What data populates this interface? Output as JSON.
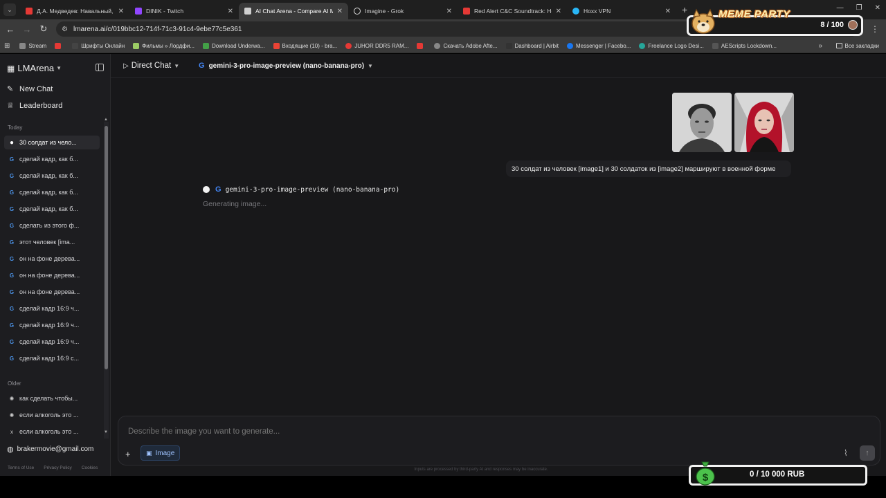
{
  "browser": {
    "tabs": [
      {
        "title": "Д.А. Медведев: Навальный, юр",
        "color": "#e53935",
        "active": false
      },
      {
        "title": "DINIK - Twitch",
        "color": "#9146ff",
        "active": false
      },
      {
        "title": "AI Chat Arena - Compare AI Mo",
        "color": "#cfcfcf",
        "active": true
      },
      {
        "title": "Imagine - Grok",
        "color": "#dddddd",
        "active": false
      },
      {
        "title": "Red Alert C&C Soundtrack: Hel",
        "color": "#e53935",
        "active": false
      },
      {
        "title": "Hoxx VPN",
        "color": "#29b6f6",
        "active": false
      }
    ],
    "url": "lmarena.ai/c/019bbc12-714f-71c3-91c4-9ebe77c5e361",
    "bookmarks": [
      {
        "label": "Stream",
        "color": "#888888"
      },
      {
        "label": "",
        "color": "#e53935"
      },
      {
        "label": "Шрифты Онлайн",
        "color": "#444444"
      },
      {
        "label": "Фильмы » Лордфи...",
        "color": "#9ccc65"
      },
      {
        "label": "Download Underwa...",
        "color": "#43a047"
      },
      {
        "label": "Входящие (10) - bra...",
        "color": "#ea4335"
      },
      {
        "label": "JUHOR DDR5 RAM...",
        "color": "#e53935"
      },
      {
        "label": "",
        "color": "#e53935"
      },
      {
        "label": "Скачать Adobe Afte...",
        "color": "#888888"
      },
      {
        "label": "Dashboard | Airbit",
        "color": "#333333"
      },
      {
        "label": "Messenger | Facebo...",
        "color": "#1877f2"
      },
      {
        "label": "Freelance Logo Desi...",
        "color": "#26a69a"
      },
      {
        "label": "AEScripts Lockdown...",
        "color": "#555555"
      }
    ],
    "all_bookmarks": "Все закладки"
  },
  "sidebar": {
    "brand": "LMArena",
    "new_chat": "New Chat",
    "leaderboard": "Leaderboard",
    "today_label": "Today",
    "today": [
      {
        "label": "30 солдат из чело...",
        "icon": "dot"
      },
      {
        "label": "сделай кадр, как б...",
        "icon": "google"
      },
      {
        "label": "сделай кадр, как б...",
        "icon": "google"
      },
      {
        "label": "сделай кадр, как б...",
        "icon": "google"
      },
      {
        "label": "сделай кадр, как б...",
        "icon": "google"
      },
      {
        "label": "сделать из этого ф...",
        "icon": "google"
      },
      {
        "label": "этот человек [ima...",
        "icon": "google"
      },
      {
        "label": "он на фоне дерева...",
        "icon": "google"
      },
      {
        "label": "он на фоне дерева...",
        "icon": "google"
      },
      {
        "label": "он на фоне дерева...",
        "icon": "google"
      },
      {
        "label": "сделай кадр 16:9 ч...",
        "icon": "google"
      },
      {
        "label": "сделай кадр 16:9 ч...",
        "icon": "google"
      },
      {
        "label": "сделай кадр 16:9 ч...",
        "icon": "google"
      },
      {
        "label": "сделай кадр 16:9 с...",
        "icon": "google"
      }
    ],
    "older_label": "Older",
    "older": [
      {
        "label": "как сделать чтобы...",
        "icon": "openai"
      },
      {
        "label": "если алкоголь это ...",
        "icon": "openai"
      },
      {
        "label": "если алкоголь это ...",
        "icon": "xai"
      }
    ],
    "account": "brakermovie@gmail.com",
    "footer": [
      "Terms of Use",
      "Privacy Policy",
      "Cookies"
    ]
  },
  "main": {
    "mode": "Direct Chat",
    "model": "gemini-3-pro-image-preview (nano-banana-pro)",
    "user_message": "30 солдат из человек [image1] и 30 солдаток из [image2] маршируют в военной форме",
    "response_model": "gemini-3-pro-image-preview (nano-banana-pro)",
    "response_status": "Generating image...",
    "composer_placeholder": "Describe the image you want to generate...",
    "image_chip": "Image",
    "disclaimer": "Inputs are processed by third-party AI and responses may be inaccurate."
  },
  "overlays": {
    "meme_title": "MEME PARTY",
    "meme_count": "8 / 100",
    "rub": "0 / 10 000 RUB"
  }
}
